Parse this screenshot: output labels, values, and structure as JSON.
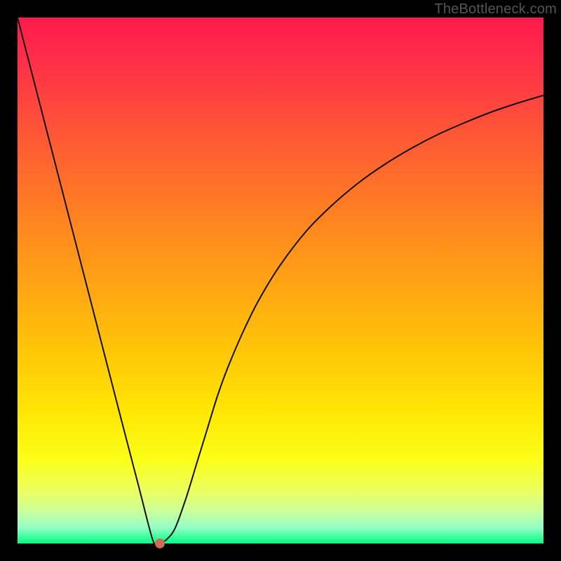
{
  "watermark": "TheBottleneck.com",
  "colors": {
    "frame": "#000000",
    "curve_stroke": "#111111",
    "marker": "#d06a52"
  },
  "chart_data": {
    "type": "line",
    "title": "",
    "xlabel": "",
    "ylabel": "",
    "xlim": [
      0,
      100
    ],
    "ylim": [
      0,
      100
    ],
    "grid": false,
    "series": [
      {
        "name": "bottleneck-curve",
        "x": [
          0,
          4,
          8,
          12,
          16,
          20,
          23,
          25.6,
          26.5,
          27.5,
          28.6,
          30,
          32,
          34,
          36,
          38,
          40,
          43,
          46,
          50,
          55,
          60,
          65,
          70,
          75,
          80,
          85,
          90,
          95,
          100
        ],
        "y": [
          100,
          84.5,
          69,
          53.5,
          38,
          22.5,
          11,
          1,
          0,
          0.2,
          1,
          3,
          8.5,
          15,
          21.5,
          28,
          33.5,
          40.5,
          46.5,
          53,
          59.5,
          64.5,
          68.7,
          72.2,
          75.2,
          77.8,
          80,
          82,
          83.7,
          85.2
        ]
      }
    ],
    "annotations": [
      {
        "name": "min-marker",
        "x": 27,
        "y": 0
      }
    ]
  }
}
